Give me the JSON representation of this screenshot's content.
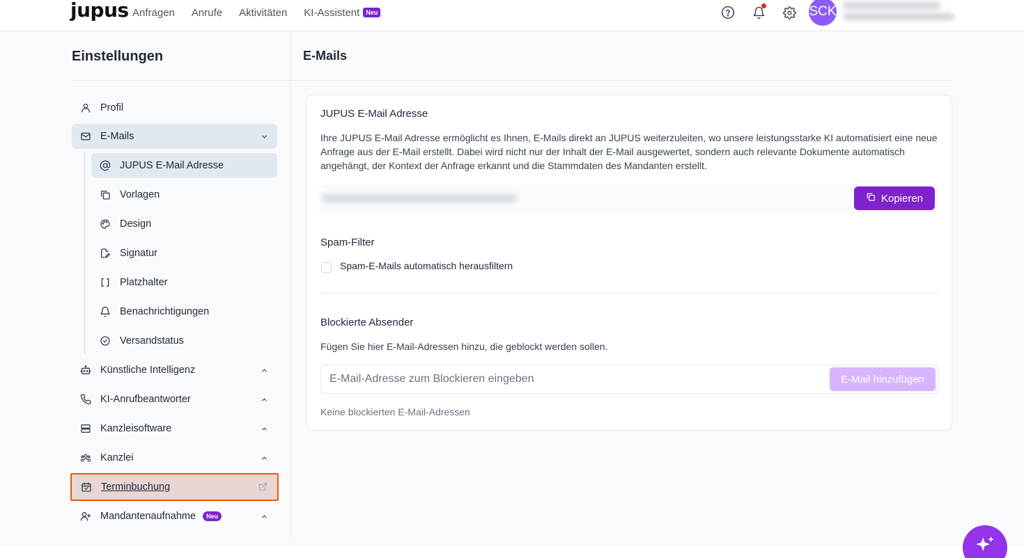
{
  "brand": {
    "logo": "jupus",
    "accent": "#7e22ce"
  },
  "topnav": {
    "items": [
      {
        "label": "Anfragen"
      },
      {
        "label": "Anrufe"
      },
      {
        "label": "Aktivitäten"
      },
      {
        "label": "KI-Assistent",
        "badge": "Neu"
      }
    ],
    "avatar_initials": "SCK"
  },
  "sidebar": {
    "title": "Einstellungen",
    "items": [
      {
        "label": "Profil",
        "icon": "user-icon"
      },
      {
        "label": "E-Mails",
        "icon": "mail-icon",
        "expanded": true
      },
      {
        "label": "JUPUS E-Mail Adresse",
        "icon": "at-icon",
        "active": true
      },
      {
        "label": "Vorlagen",
        "icon": "copy-icon"
      },
      {
        "label": "Design",
        "icon": "palette-icon"
      },
      {
        "label": "Signatur",
        "icon": "signature-icon"
      },
      {
        "label": "Platzhalter",
        "icon": "brackets-icon"
      },
      {
        "label": "Benachrichtigungen",
        "icon": "bell-icon"
      },
      {
        "label": "Versandstatus",
        "icon": "check-circle-icon"
      },
      {
        "label": "Künstliche Intelligenz",
        "icon": "robot-icon"
      },
      {
        "label": "KI-Anrufbeantworter",
        "icon": "phone-icon"
      },
      {
        "label": "Kanzleisoftware",
        "icon": "server-icon"
      },
      {
        "label": "Kanzlei",
        "icon": "users-icon"
      },
      {
        "label": "Terminbuchung",
        "icon": "calendar-check-icon"
      },
      {
        "label": "Mandantenaufnahme",
        "icon": "user-plus-icon",
        "badge": "Neu"
      }
    ]
  },
  "main": {
    "title": "E-Mails",
    "jupus_email": {
      "heading": "JUPUS E-Mail Adresse",
      "description": "Ihre JUPUS E-Mail Adresse ermöglicht es Ihnen, E-Mails direkt an JUPUS weiterzuleiten, wo unsere leistungsstarke KI automatisiert eine neue Anfrage aus der E-Mail erstellt. Dabei wird nicht nur der Inhalt der E-Mail ausgewertet, sondern auch relevante Dokumente automatisch angehängt, der Kontext der Anfrage erkannt und die Stammdaten des Mandanten erstellt.",
      "copy_label": "Kopieren"
    },
    "spam": {
      "heading": "Spam-Filter",
      "checkbox_label": "Spam-E-Mails automatisch herausfiltern"
    },
    "blocked": {
      "heading": "Blockierte Absender",
      "description": "Fügen Sie hier E-Mail-Adressen hinzu, die geblockt werden sollen.",
      "placeholder": "E-Mail-Adresse zum Blockieren eingeben",
      "add_label": "E-Mail hinzufügen",
      "empty_note": "Keine blockierten E-Mail-Adressen"
    }
  }
}
